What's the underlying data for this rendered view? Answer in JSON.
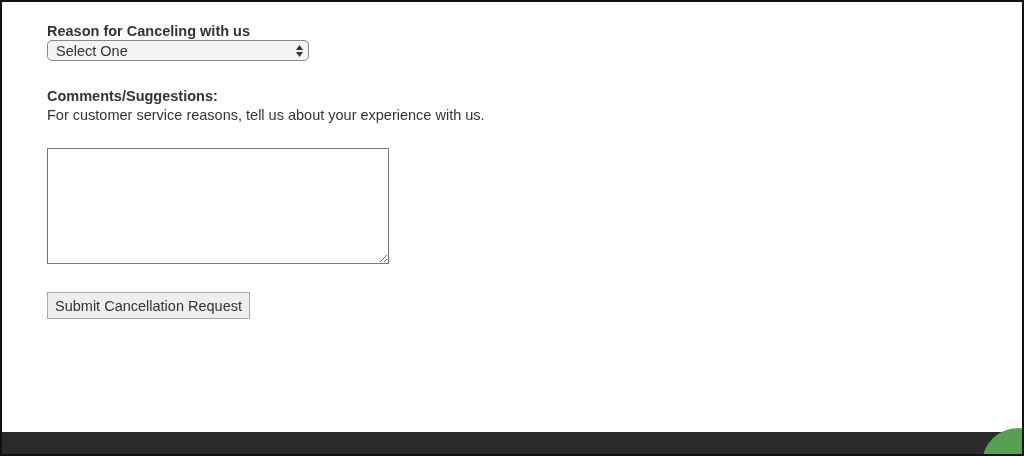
{
  "form": {
    "reason_label": "Reason for Canceling with us",
    "reason_select": {
      "value": "Select One"
    },
    "comments_label": "**Comments/Suggestions**:",
    "comments_hint": "For customer service reasons, tell us about your experience with us.",
    "submit_button": "Submit Cancellation Request"
  }
}
